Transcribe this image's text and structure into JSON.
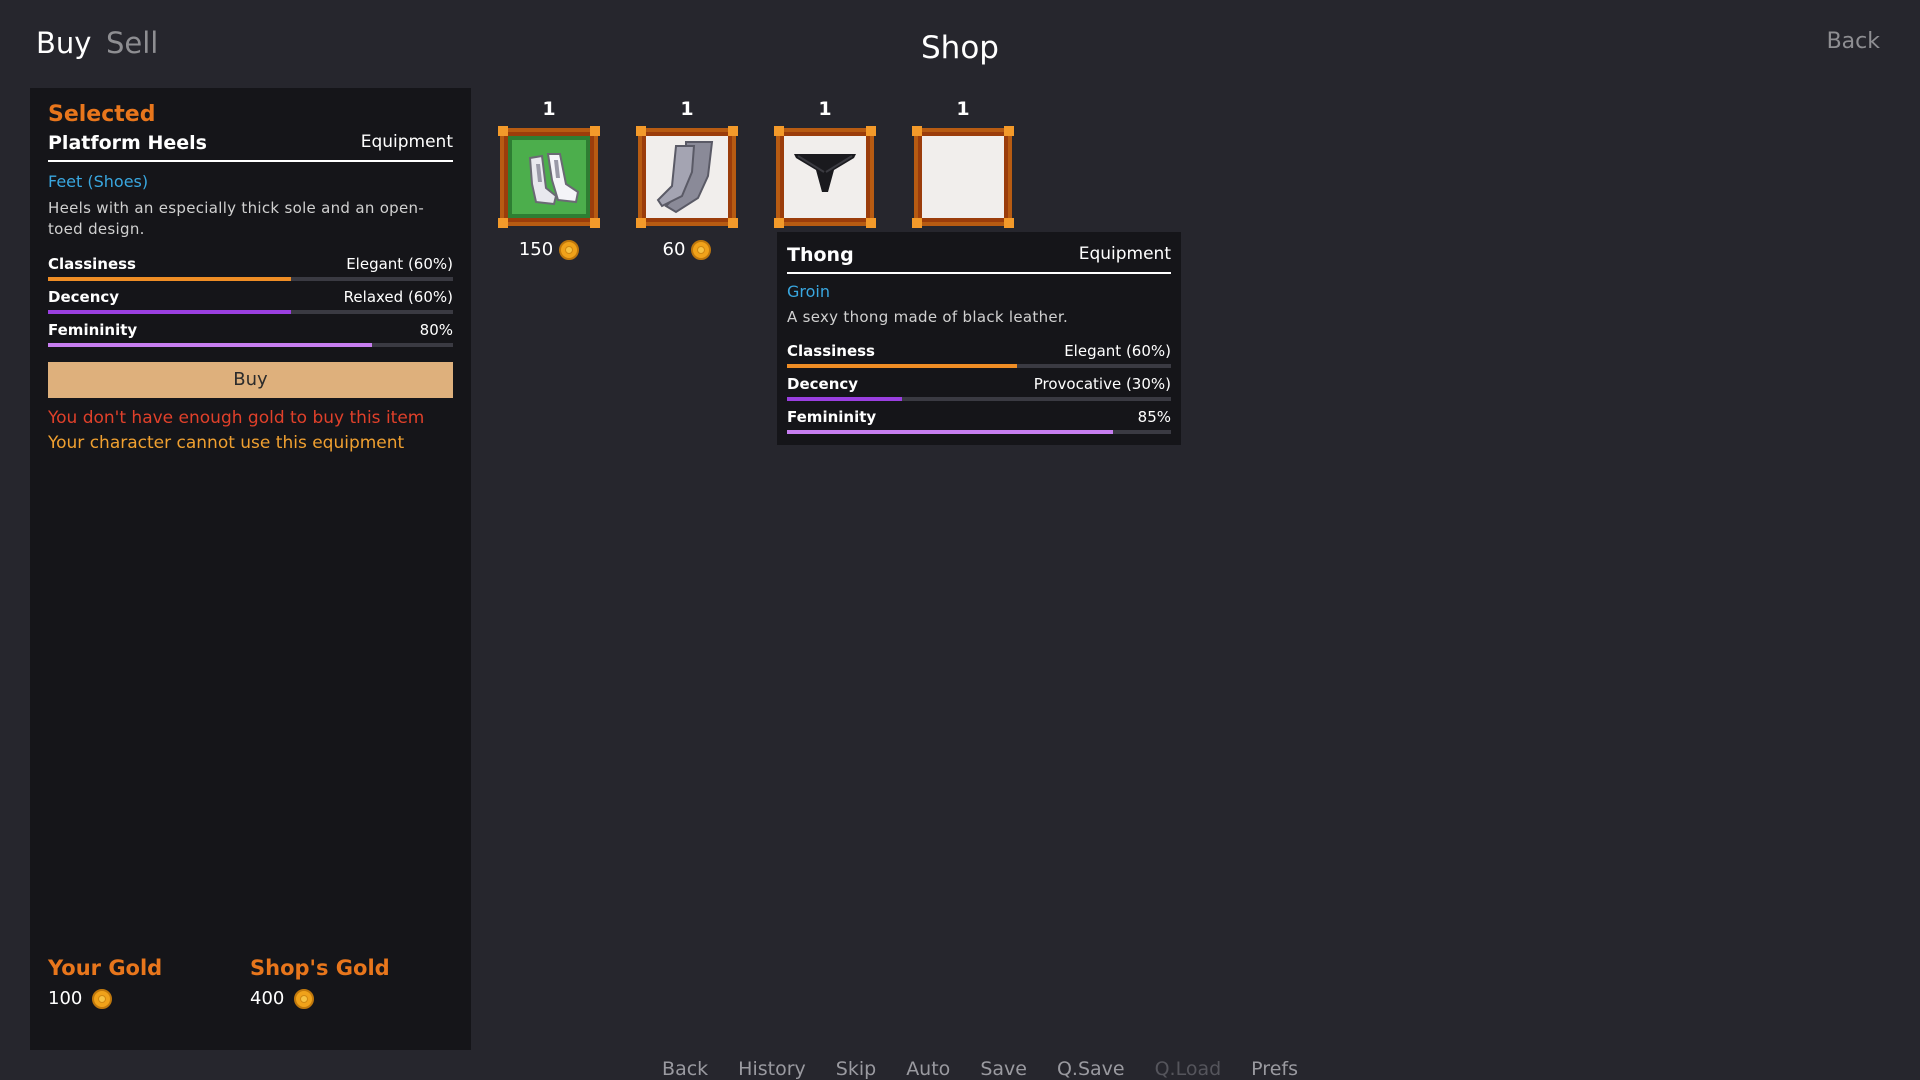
{
  "tabs": {
    "buy": "Buy",
    "sell": "Sell"
  },
  "title": "Shop",
  "back_label": "Back",
  "selected": {
    "heading": "Selected",
    "name": "Platform Heels",
    "category": "Equipment",
    "slot": "Feet (Shoes)",
    "description": "Heels with an especially thick sole and an open-toed design.",
    "stats": [
      {
        "name": "Classiness",
        "value": "Elegant (60%)",
        "level": 0.6,
        "color": "#ef8d25"
      },
      {
        "name": "Decency",
        "value": "Relaxed (60%)",
        "level": 0.6,
        "color": "#9a3fe0"
      },
      {
        "name": "Femininity",
        "value": "80%",
        "level": 0.8,
        "color": "#c77ef0"
      }
    ],
    "buy_label": "Buy",
    "warning_gold": "You don't have enough gold to buy this item",
    "warning_equip": "Your character cannot use this equipment"
  },
  "your_gold": {
    "label": "Your Gold",
    "value": "100"
  },
  "shop_gold": {
    "label": "Shop's Gold",
    "value": "400"
  },
  "shop_items": [
    {
      "count": "1",
      "price": "150",
      "icon": "platform-heels-icon"
    },
    {
      "count": "1",
      "price": "60",
      "icon": "stockings-icon"
    },
    {
      "count": "1",
      "price": "",
      "icon": "thong-icon"
    },
    {
      "count": "1",
      "price": "",
      "icon": "empty"
    }
  ],
  "tooltip": {
    "name": "Thong",
    "category": "Equipment",
    "slot": "Groin",
    "description": "A sexy thong made of black leather.",
    "stats": [
      {
        "name": "Classiness",
        "value": "Elegant (60%)",
        "level": 0.6,
        "color": "#ef8d25"
      },
      {
        "name": "Decency",
        "value": "Provocative (30%)",
        "level": 0.3,
        "color": "#9a3fe0"
      },
      {
        "name": "Femininity",
        "value": "85%",
        "level": 0.85,
        "color": "#c77ef0"
      }
    ]
  },
  "quick_menu": [
    "Back",
    "History",
    "Skip",
    "Auto",
    "Save",
    "Q.Save",
    "Q.Load",
    "Prefs"
  ]
}
